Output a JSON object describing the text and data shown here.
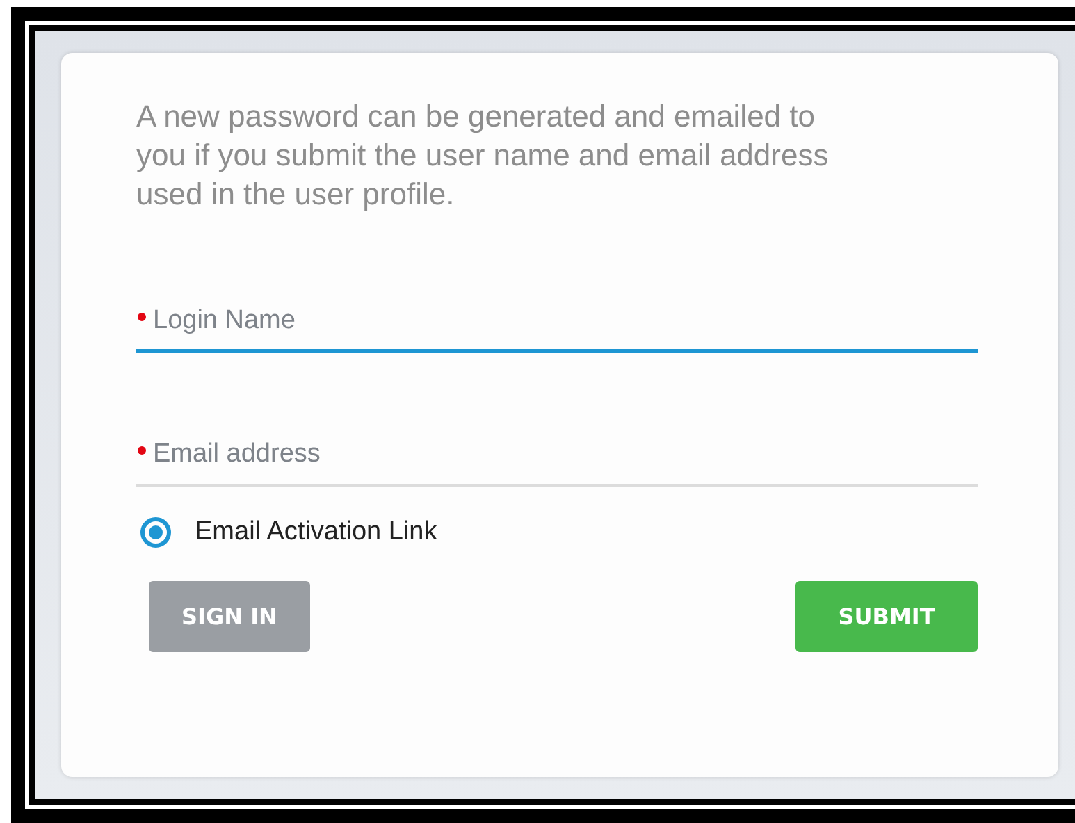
{
  "message": "A new password can be generated and emailed to you if you submit the user name and email address used in the user profile.",
  "fields": [
    {
      "placeholder": "Login Name",
      "required": true,
      "focused": true
    },
    {
      "placeholder": "Email address",
      "required": true,
      "focused": false
    }
  ],
  "options": [
    {
      "label": "Email Activation Link",
      "selected": true
    }
  ],
  "buttons": [
    {
      "label": "SIGN IN",
      "kind": "secondary"
    },
    {
      "label": "SUBMIT",
      "kind": "primary"
    }
  ]
}
